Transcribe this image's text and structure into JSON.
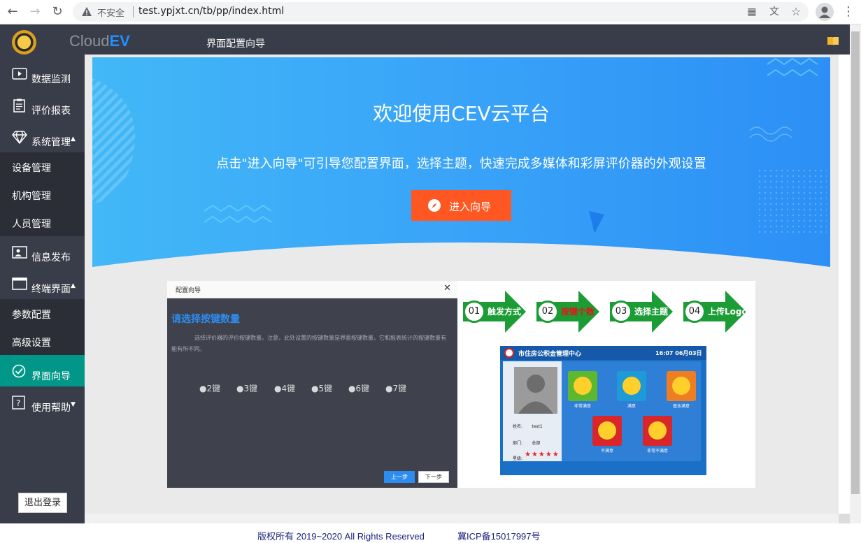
{
  "browser": {
    "security_label": "不安全",
    "url": "test.ypjxt.cn/tb/pp/index.html"
  },
  "header": {
    "brand_prefix": "Cloud",
    "brand_suffix": "EV",
    "title": "界面配置向导"
  },
  "sidebar": {
    "items": [
      {
        "label": "数据监测",
        "icon": "video-icon"
      },
      {
        "label": "评价报表",
        "icon": "clipboard-icon"
      },
      {
        "label": "系统管理",
        "icon": "diamond-icon"
      },
      {
        "label": "信息发布",
        "icon": "image-icon"
      },
      {
        "label": "终端界面",
        "icon": "window-icon"
      },
      {
        "label": "界面向导",
        "icon": "check-circle-icon"
      },
      {
        "label": "使用帮助",
        "icon": "help-icon"
      }
    ],
    "system_sub": [
      "设备管理",
      "机构管理",
      "人员管理"
    ],
    "terminal_sub": [
      "参数配置",
      "高级设置"
    ],
    "logout_label": "退出登录"
  },
  "banner": {
    "title": "欢迎使用CEV云平台",
    "subtitle": "点击\"进入向导\"可引导您配置界面，选择主题，快速完成多媒体和彩屏评价器的外观设置",
    "button_label": "进入向导"
  },
  "dialog": {
    "title": "配置向导",
    "heading": "请选择按键数量",
    "description": "选择评价器的评价按键数量。注意，此处设置的按键数量是界面按键数量，它和报表统计的按键数量有能有所不同。",
    "options": [
      "●2键",
      "●3键",
      "●4键",
      "●5键",
      "●6键",
      "●7键"
    ],
    "prev_label": "上一步",
    "next_label": "下一步"
  },
  "steps": [
    {
      "num": "01",
      "label": "触发方式",
      "color": "#ffffff"
    },
    {
      "num": "02",
      "label": "按键个数",
      "color": "#e8141b"
    },
    {
      "num": "03",
      "label": "选择主题",
      "color": "#ffffff"
    },
    {
      "num": "04",
      "label": "上传Logo",
      "color": "#ffffff"
    }
  ],
  "device": {
    "org": "市住房公积金管理中心",
    "time": "16:07  06月03日",
    "name_label": "姓名:",
    "name_value": "test1",
    "dept_label": "部门:",
    "dept_value": "总部",
    "star_label": "星级:",
    "stars": "★★★★★",
    "faces": [
      {
        "label": "非常满意",
        "color": "#5cb82e"
      },
      {
        "label": "满意",
        "color": "#1e9ad6"
      },
      {
        "label": "基本满意",
        "color": "#ef7d22"
      },
      {
        "label": "不满意",
        "color": "#d8262b"
      },
      {
        "label": "非常不满意",
        "color": "#d8262b"
      }
    ]
  },
  "footer": {
    "copyright": "版权所有 2019~2020 All Rights Reserved",
    "icp": "冀ICP备15017997号"
  }
}
